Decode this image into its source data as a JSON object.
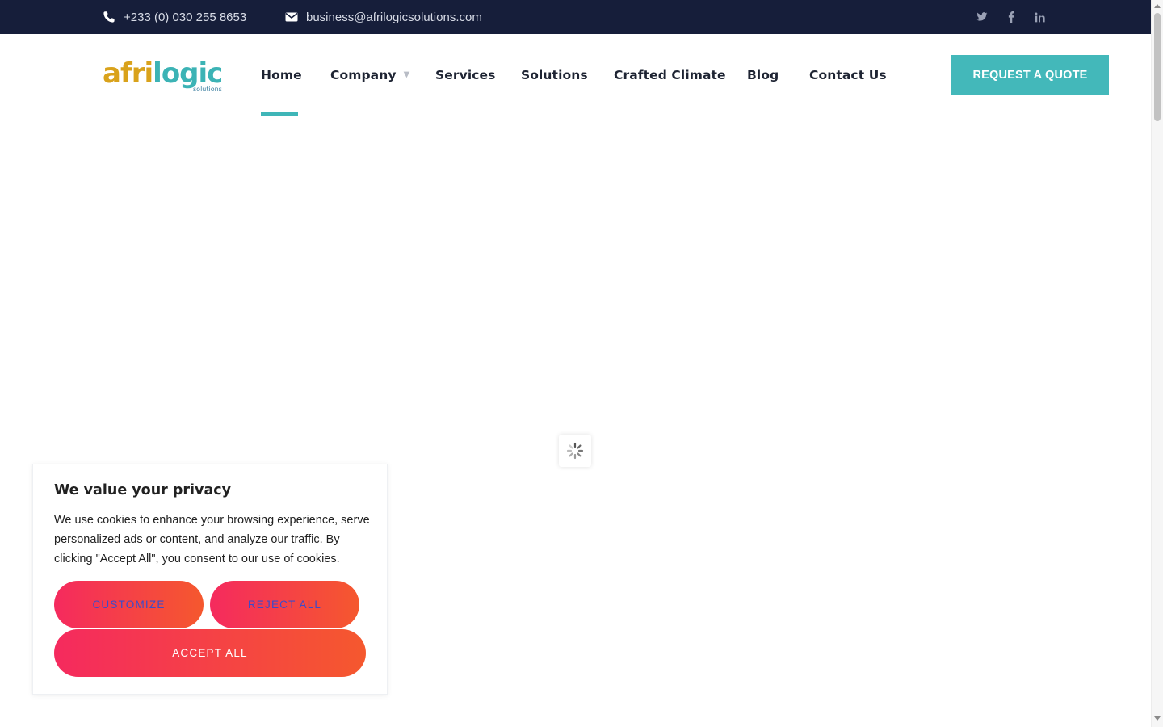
{
  "topbar": {
    "phone": "+233 (0) 030 255 8653",
    "email": "business@afrilogicsolutions.com",
    "social": [
      "twitter-icon",
      "facebook-icon",
      "linkedin-icon"
    ]
  },
  "header": {
    "logo_text": "afrilogic",
    "logo_sub": "solutions",
    "nav": {
      "home": "Home",
      "company": "Company",
      "services": "Services",
      "solutions": "Solutions",
      "crafted_climate": "Crafted Climate",
      "blog": "Blog",
      "contact": "Contact Us"
    },
    "active_item": "Home",
    "cta": "REQUEST A QUOTE"
  },
  "cookie_banner": {
    "title": "We value your privacy",
    "text": "We use cookies to enhance your browsing experience, serve personalized ads or content, and analyze our traffic. By clicking \"Accept All\", you consent to our use of cookies.",
    "customize": "CUSTOMIZE",
    "reject": "REJECT ALL",
    "accept": "ACCEPT ALL"
  },
  "colors": {
    "topbar_bg": "#161e3a",
    "accent": "#43b8ba",
    "cookie_gradient_start": "#f52a5e",
    "cookie_gradient_end": "#f5582e",
    "cookie_secondary_text": "#3d4bc9"
  }
}
